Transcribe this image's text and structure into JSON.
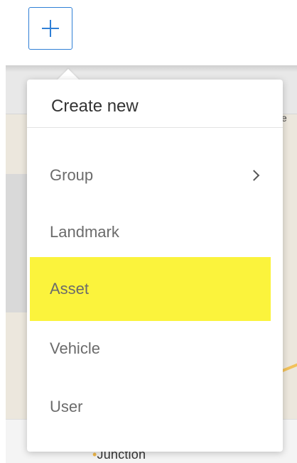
{
  "toolbar": {
    "add_icon": "plus-icon",
    "accent_color": "#2f7fd6"
  },
  "map": {
    "visible_label": "Junction"
  },
  "menu": {
    "title": "Create new",
    "highlight_color": "#fbf33c",
    "items": [
      {
        "label": "Group",
        "has_submenu": true,
        "submenu_icon": "chevron-right-icon"
      },
      {
        "label": "Landmark",
        "has_submenu": false
      },
      {
        "label": "Asset",
        "has_submenu": false,
        "highlighted": true
      },
      {
        "label": "Vehicle",
        "has_submenu": false
      },
      {
        "label": "User",
        "has_submenu": false
      }
    ]
  }
}
